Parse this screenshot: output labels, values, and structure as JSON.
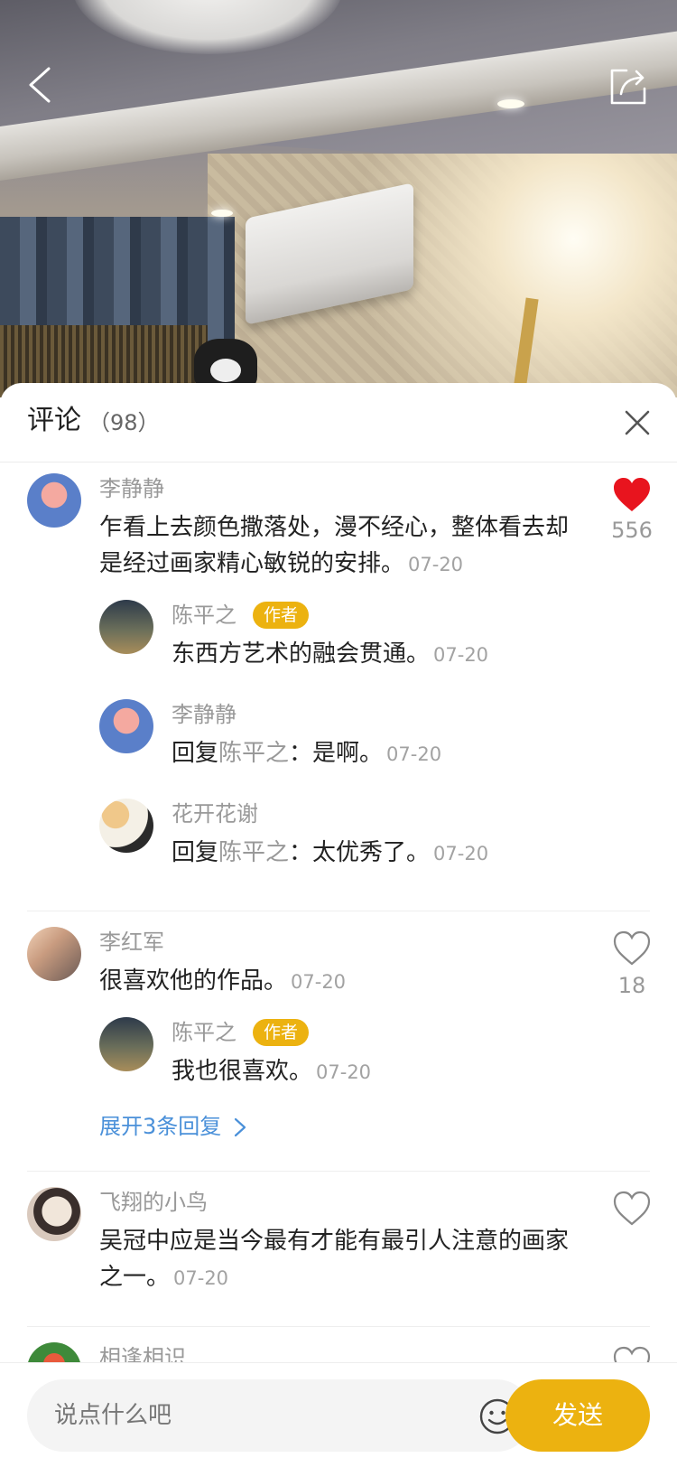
{
  "header": {
    "back_icon": "chevron-left-icon",
    "share_icon": "share-icon"
  },
  "sheet": {
    "title": "评论",
    "count": "（98）",
    "close_icon": "close-icon"
  },
  "comments": [
    {
      "user": "李静静",
      "text": "乍看上去颜色撒落处，漫不经心，整体看去却是经过画家精心敏锐的安排。",
      "time": "07-20",
      "likes": "556",
      "liked": true,
      "replies": [
        {
          "user": "陈平之",
          "badge": "作者",
          "text": "东西方艺术的融会贯通。",
          "time": "07-20"
        },
        {
          "user": "李静静",
          "prefix": "回复",
          "target": "陈平之",
          "text": "：是啊。",
          "time": "07-20"
        },
        {
          "user": "花开花谢",
          "prefix": "回复",
          "target": "陈平之",
          "text": "：太优秀了。",
          "time": "07-20"
        }
      ]
    },
    {
      "user": "李红军",
      "text": "很喜欢他的作品。",
      "time": "07-20",
      "likes": "18",
      "liked": false,
      "replies": [
        {
          "user": "陈平之",
          "badge": "作者",
          "text": "我也很喜欢。",
          "time": "07-20"
        }
      ],
      "expand_label": "展开3条回复"
    },
    {
      "user": "飞翔的小鸟",
      "text": "吴冠中应是当今最有才能有最引人注意的画家之一。",
      "time": "07-20",
      "liked": false
    },
    {
      "user": "相逢相识"
    }
  ],
  "bottom_bar": {
    "placeholder": "说点什么吧",
    "emoji_icon": "smiley-icon",
    "send_label": "发送"
  },
  "colors": {
    "accent": "#ecb210",
    "like_red": "#e8141e",
    "link_blue": "#4a90d9",
    "secondary_text": "#999999",
    "primary_text": "#222222"
  }
}
